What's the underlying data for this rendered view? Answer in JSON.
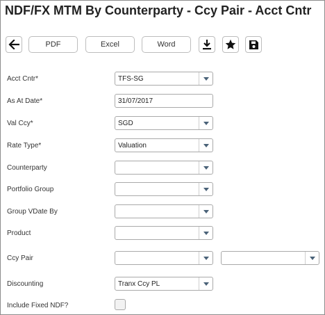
{
  "title": "NDF/FX MTM By Counterparty - Ccy Pair - Acct Cntr",
  "toolbar": {
    "pdf_label": "PDF",
    "excel_label": "Excel",
    "word_label": "Word"
  },
  "form": {
    "acct_cntr": {
      "label": "Acct Cntr*",
      "value": "TFS-SG"
    },
    "as_at_date": {
      "label": "As At Date*",
      "value": "31/07/2017"
    },
    "val_ccy": {
      "label": "Val Ccy*",
      "value": "SGD"
    },
    "rate_type": {
      "label": "Rate Type*",
      "value": "Valuation"
    },
    "counterparty": {
      "label": "Counterparty",
      "value": ""
    },
    "portfolio_group": {
      "label": "Portfolio Group",
      "value": ""
    },
    "group_vdate_by": {
      "label": "Group VDate By",
      "value": ""
    },
    "product": {
      "label": "Product",
      "value": ""
    },
    "ccy_pair": {
      "label": "Ccy Pair",
      "value1": "",
      "value2": ""
    },
    "discounting": {
      "label": "Discounting",
      "value": "Tranx Ccy PL"
    },
    "include_fixed_ndf": {
      "label": "Include Fixed NDF?",
      "checked": false
    }
  },
  "icons": {
    "back": "arrow-left-icon",
    "download": "download-icon",
    "favorite": "star-icon",
    "save": "save-icon"
  }
}
